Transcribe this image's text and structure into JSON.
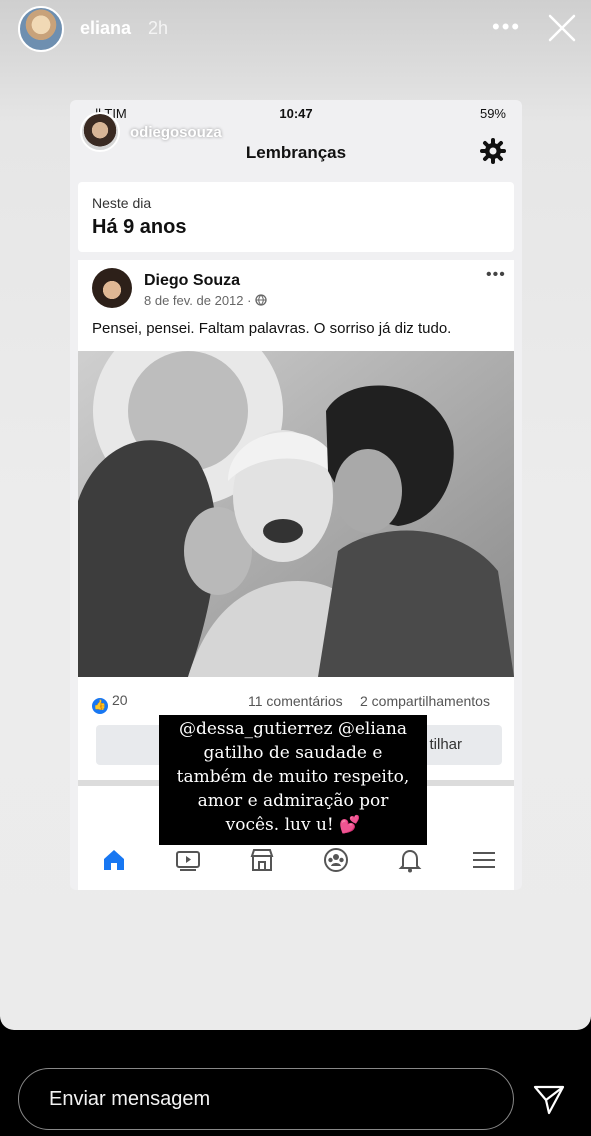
{
  "story": {
    "username": "eliana",
    "time": "2h",
    "more_icon": "more-horizontal-icon",
    "close_icon": "close-icon"
  },
  "screenshot": {
    "status": {
      "carrier": "..ll TIM",
      "time": "10:47",
      "battery": "59%"
    },
    "ig_handle": "odiegosouza",
    "title": "Lembranças",
    "day_card": {
      "label": "Neste dia",
      "value": "Há 9 anos"
    },
    "post": {
      "author": "Diego Souza",
      "date": "8 de fev. de 2012 ·",
      "text": "Pensei, pensei. Faltam palavras. O sorriso já diz tudo.",
      "likes": "20",
      "comments": "11 comentários",
      "shares": "2 compartilhamentos",
      "share_button": "tilhar"
    },
    "tabs": [
      "home-icon",
      "video-icon",
      "marketplace-icon",
      "groups-icon",
      "bell-icon",
      "menu-icon"
    ]
  },
  "caption": {
    "lines": [
      "@dessa_gutierrez @eliana",
      "gatilho de saudade e",
      "também de muito respeito,",
      "amor e admiração por",
      "vocês. luv u! 💕"
    ]
  },
  "reply": {
    "placeholder": "Enviar mensagem"
  },
  "colors": {
    "facebook_blue": "#1877f2",
    "background": "#000000"
  }
}
